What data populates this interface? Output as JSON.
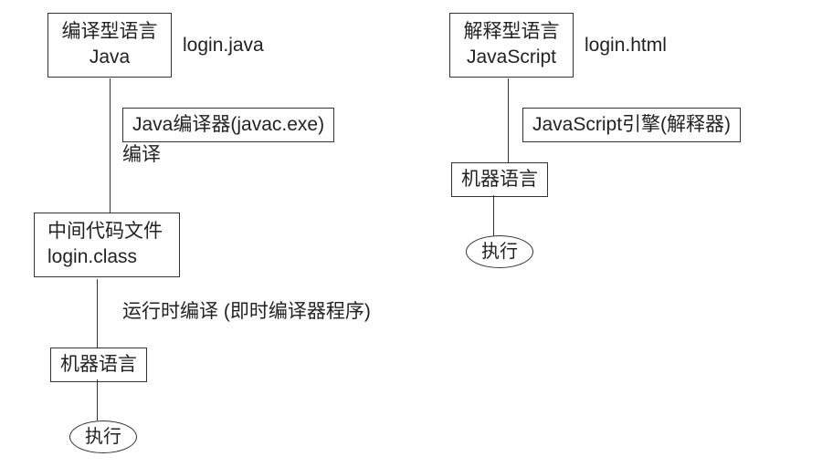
{
  "left": {
    "source_box": {
      "line1": "编译型语言",
      "line2": "Java"
    },
    "source_file": "login.java",
    "compiler_box": "Java编译器(javac.exe)",
    "compile_label": "编译",
    "intermediate_box": {
      "line1": "中间代码文件",
      "line2": "login.class"
    },
    "jit_label": "运行时编译 (即时编译器程序)",
    "machine_box": "机器语言",
    "execute": "执行"
  },
  "right": {
    "source_box": {
      "line1": "解释型语言",
      "line2": "JavaScript"
    },
    "source_file": "login.html",
    "engine_box": "JavaScript引擎(解释器)",
    "machine_box": "机器语言",
    "execute": "执行"
  }
}
